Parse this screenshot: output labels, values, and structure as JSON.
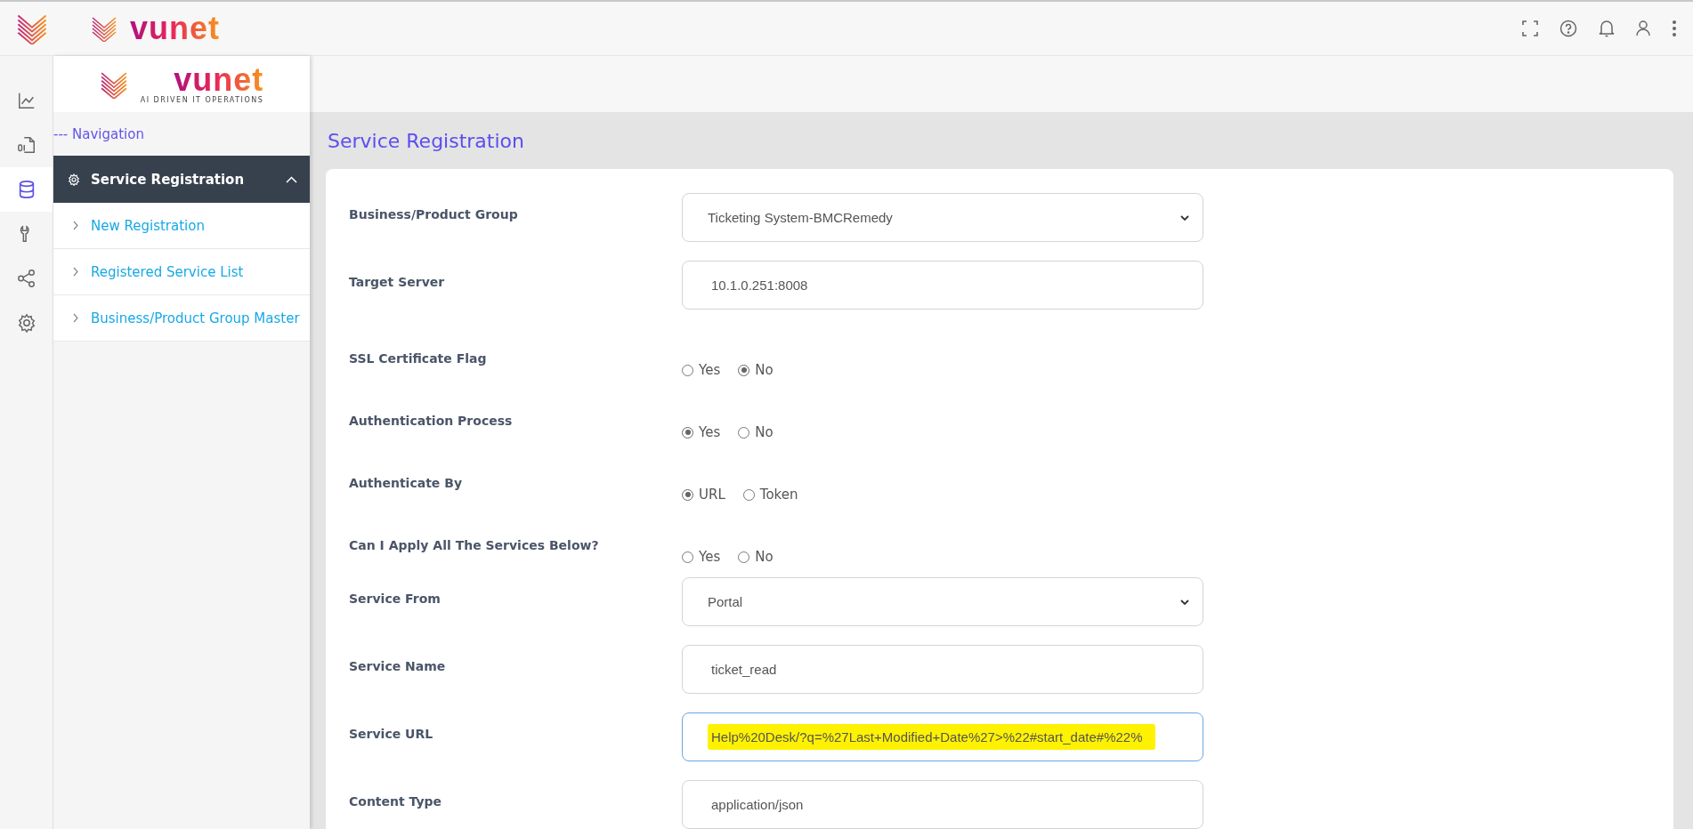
{
  "top_bar": {
    "logo_text": "vunet"
  },
  "rail": [
    {
      "kind": "chart",
      "selected": false
    },
    {
      "kind": "file",
      "selected": false
    },
    {
      "kind": "database",
      "selected": true
    },
    {
      "kind": "wrench",
      "selected": false
    },
    {
      "kind": "share",
      "selected": false
    },
    {
      "kind": "gear",
      "selected": false
    }
  ],
  "sidebar": {
    "logo_text": "vunet",
    "logo_tagline": "AI DRIVEN IT OPERATIONS",
    "nav_label": "--- Navigation",
    "section": {
      "label": "Service Registration",
      "expanded": true,
      "items": [
        {
          "label": "New Registration"
        },
        {
          "label": "Registered Service List"
        },
        {
          "label": "Business/Product Group Master"
        }
      ]
    }
  },
  "page_title": "Service Registration",
  "form": {
    "fields": [
      {
        "label": "Business/Product Group",
        "kind": "select",
        "value": "Ticketing System-BMCRemedy"
      },
      {
        "label": "Target Server",
        "kind": "text",
        "value": "10.1.0.251:8008"
      },
      {
        "label": "SSL Certificate Flag",
        "kind": "radio",
        "options": [
          {
            "label": "Yes",
            "selected": false
          },
          {
            "label": "No",
            "selected": true
          }
        ]
      },
      {
        "label": "Authentication Process",
        "kind": "radio",
        "options": [
          {
            "label": "Yes",
            "selected": true
          },
          {
            "label": "No",
            "selected": false
          }
        ]
      },
      {
        "label": "Authenticate By",
        "kind": "radio",
        "options": [
          {
            "label": "URL",
            "selected": true
          },
          {
            "label": "Token",
            "selected": false
          }
        ]
      },
      {
        "label": "Can I Apply All The Services Below?",
        "kind": "radio",
        "options": [
          {
            "label": "Yes",
            "selected": false
          },
          {
            "label": "No",
            "selected": false
          }
        ]
      },
      {
        "label": "Service From",
        "kind": "select",
        "value": "Portal"
      },
      {
        "label": "Service Name",
        "kind": "text",
        "value": "ticket_read"
      },
      {
        "label": "Service URL",
        "kind": "text",
        "value": "Help%20Desk/?q=%27Last+Modified+Date%27>%22#start_date#%22%",
        "focused": true,
        "highlighted": true
      },
      {
        "label": "Content Type",
        "kind": "text",
        "value": "application/json"
      }
    ]
  }
}
